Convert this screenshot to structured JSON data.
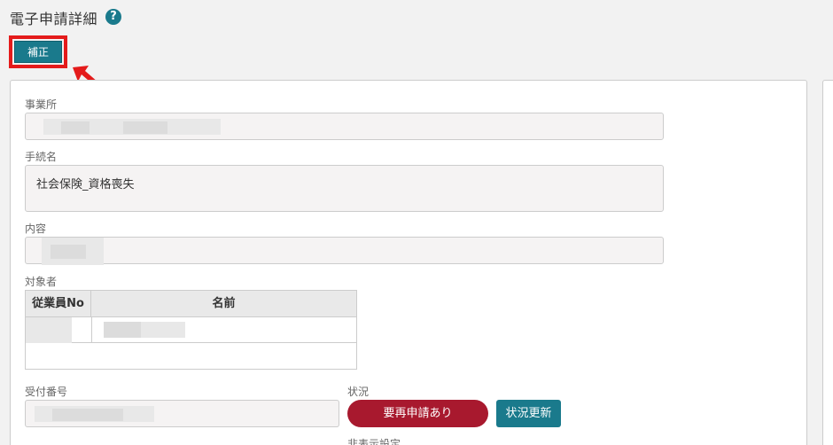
{
  "header": {
    "title": "電子申請詳細",
    "help_icon": "?"
  },
  "toolbar": {
    "correction_label": "補正"
  },
  "form": {
    "office": {
      "label": "事業所",
      "value": ""
    },
    "procedure": {
      "label": "手続名",
      "value": "社会保険_資格喪失"
    },
    "content": {
      "label": "内容",
      "value": ""
    },
    "subjects": {
      "label": "対象者",
      "columns": [
        "従業員No",
        "名前"
      ],
      "rows": [
        [
          "",
          ""
        ]
      ]
    },
    "receipt": {
      "label": "受付番号",
      "value": ""
    },
    "status": {
      "label": "状況",
      "value": "要再申請あり",
      "update_label": "状況更新"
    },
    "hidden_setting": {
      "label": "非表示設定"
    }
  },
  "colors": {
    "accent": "#1a7a8c",
    "status_alert": "#a8192e",
    "highlight": "#e41b1b"
  }
}
